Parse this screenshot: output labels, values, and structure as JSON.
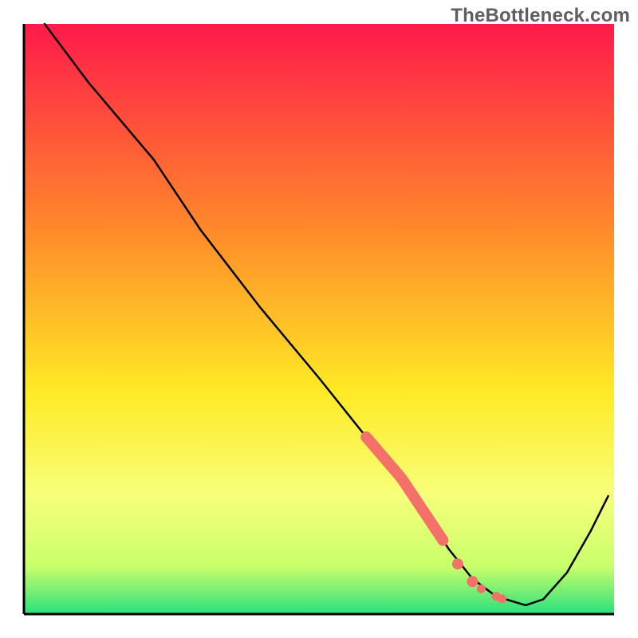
{
  "watermark": "TheBottleneck.com",
  "chart_data": {
    "type": "line",
    "title": "",
    "xlabel": "",
    "ylabel": "",
    "xlim": [
      0,
      100
    ],
    "ylim": [
      0,
      100
    ],
    "grid": false,
    "legend": false,
    "background_gradient": {
      "top": "#ff1a4b",
      "mid1": "#ff8a2a",
      "mid2": "#ffe924",
      "mid3": "#f7ff7a",
      "mid4": "#c8ff6a",
      "bottom": "#29e07d"
    },
    "curve_points": [
      {
        "x": 3.5,
        "y": 100.0
      },
      {
        "x": 11.0,
        "y": 90.0
      },
      {
        "x": 22.0,
        "y": 77.0
      },
      {
        "x": 30.0,
        "y": 65.0
      },
      {
        "x": 40.0,
        "y": 52.0
      },
      {
        "x": 50.0,
        "y": 40.0
      },
      {
        "x": 58.0,
        "y": 30.0
      },
      {
        "x": 64.0,
        "y": 23.0
      },
      {
        "x": 68.0,
        "y": 17.0
      },
      {
        "x": 72.0,
        "y": 11.0
      },
      {
        "x": 76.0,
        "y": 6.0
      },
      {
        "x": 80.0,
        "y": 3.0
      },
      {
        "x": 85.0,
        "y": 1.5
      },
      {
        "x": 88.0,
        "y": 2.5
      },
      {
        "x": 92.0,
        "y": 7.0
      },
      {
        "x": 96.0,
        "y": 14.0
      },
      {
        "x": 99.0,
        "y": 20.0
      }
    ],
    "highlight_segment": {
      "x_start": 58.0,
      "x_end": 71.0
    },
    "highlight_dots": [
      {
        "x": 73.5,
        "y": 8.5
      },
      {
        "x": 76.0,
        "y": 5.5
      },
      {
        "x": 77.5,
        "y": 4.3
      },
      {
        "x": 80.0,
        "y": 3.0
      },
      {
        "x": 81.0,
        "y": 2.6
      }
    ]
  }
}
